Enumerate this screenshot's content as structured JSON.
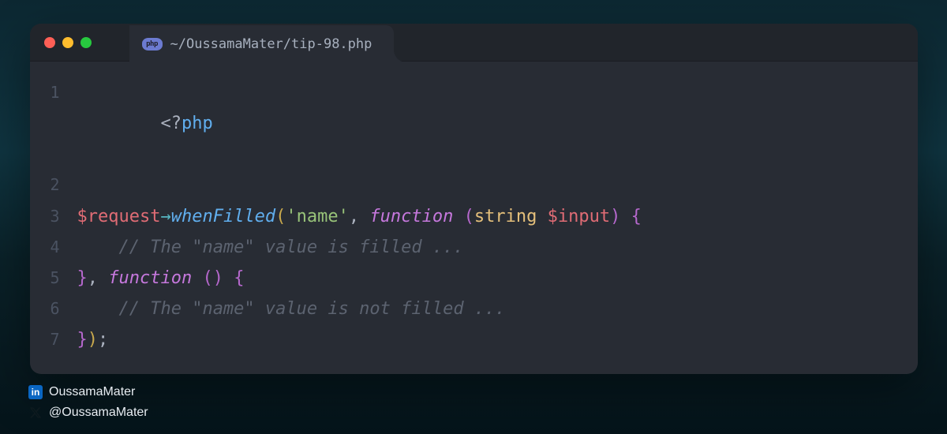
{
  "tab": {
    "badge": "php",
    "title": "~/OussamaMater/tip-98.php"
  },
  "code": {
    "l1": {
      "a": "<?",
      "b": "php"
    },
    "l3": {
      "var": "$request",
      "arrow": "→",
      "method": "whenFilled",
      "p1": "(",
      "str": "'name'",
      "c1": ", ",
      "kw1": "function",
      "sp": " ",
      "p2a": "(",
      "type": "string",
      "sp2": " ",
      "param": "$input",
      "p2b": ")",
      "sp3": " ",
      "brace": "{"
    },
    "l4": {
      "indent": "    ",
      "comment": "// The \"name\" value is filled ..."
    },
    "l5": {
      "brace_close": "}",
      "c1": ", ",
      "kw": "function",
      "sp": " ",
      "pa": "(",
      "pb": ")",
      "sp2": " ",
      "brace_open": "{"
    },
    "l6": {
      "indent": "    ",
      "comment": "// The \"name\" value is not filled ..."
    },
    "l7": {
      "brace": "}",
      "paren": ")",
      "semi": ";"
    }
  },
  "lines": [
    "1",
    "2",
    "3",
    "4",
    "5",
    "6",
    "7"
  ],
  "socials": {
    "linkedin": "OussamaMater",
    "twitter": "@OussamaMater"
  }
}
